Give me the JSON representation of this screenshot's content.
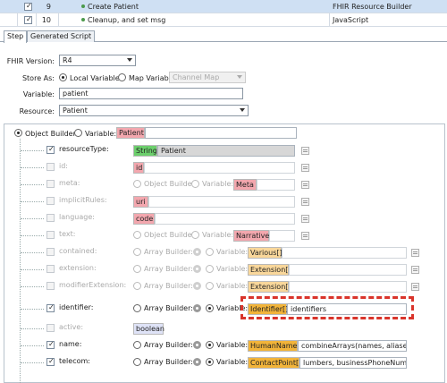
{
  "steps": [
    {
      "num": "9",
      "name": "Create Patient",
      "type": "FHIR Resource Builder",
      "checked": true,
      "selected": true
    },
    {
      "num": "10",
      "name": "Cleanup, and set msg",
      "type": "JavaScript",
      "checked": true,
      "selected": false
    }
  ],
  "tabs": [
    "Step",
    "Generated Script"
  ],
  "form": {
    "fhir_version_label": "FHIR Version:",
    "fhir_version": "R4",
    "store_as_label": "Store As:",
    "local_variable": "Local Variable",
    "map_variable": "Map Variable",
    "map_select": "Channel Map",
    "variable_label": "Variable:",
    "variable": "patient",
    "resource_label": "Resource:",
    "resource": "Patient"
  },
  "builder": {
    "object_builder": "Object Builder",
    "variable_label": "Variable:",
    "variable_value": "Patient"
  },
  "labels": {
    "object_builder": "Object Builder",
    "array_builder": "Array Builder:",
    "variable": "Variable:"
  },
  "rows": [
    {
      "name": "resourceType:",
      "checked": true,
      "enabled": true,
      "type_chip": "String",
      "value": "Patient"
    },
    {
      "name": "id:",
      "checked": false,
      "enabled": false,
      "type_chip": "id"
    },
    {
      "name": "meta:",
      "checked": false,
      "enabled": false,
      "type_chip": "Meta"
    },
    {
      "name": "implicitRules:",
      "checked": false,
      "enabled": false,
      "type_chip": "uri"
    },
    {
      "name": "language:",
      "checked": false,
      "enabled": false,
      "type_chip": "code"
    },
    {
      "name": "text:",
      "checked": false,
      "enabled": false,
      "type_chip": "Narrative"
    },
    {
      "name": "contained:",
      "checked": false,
      "enabled": false,
      "type_chip": "Various[]"
    },
    {
      "name": "extension:",
      "checked": false,
      "enabled": false,
      "type_chip": "Extension[]"
    },
    {
      "name": "modifierExtension:",
      "checked": false,
      "enabled": false,
      "type_chip": "Extension[]"
    },
    {
      "name": "identifier:",
      "checked": true,
      "enabled": true,
      "type_chip": "Identifier[]",
      "value": "identifiers"
    },
    {
      "name": "active:",
      "checked": false,
      "enabled": false,
      "type_chip": "boolean"
    },
    {
      "name": "name:",
      "checked": true,
      "enabled": true,
      "type_chip": "HumanName[]",
      "value": "combineArrays(names, aliases)"
    },
    {
      "name": "telecom:",
      "checked": true,
      "enabled": true,
      "type_chip": "ContactPoint[]",
      "value": "lumbers, businessPhoneNumbers)"
    }
  ],
  "colors": {
    "selected_row": "#cfe0f3",
    "chip_pink": "#f3a7ae",
    "chip_green": "#6ccf6c",
    "chip_orange": "#f2b43a",
    "chip_orange_light": "#f9d79a",
    "chip_lavender": "#dfe3f7",
    "highlight": "#d9342b"
  }
}
